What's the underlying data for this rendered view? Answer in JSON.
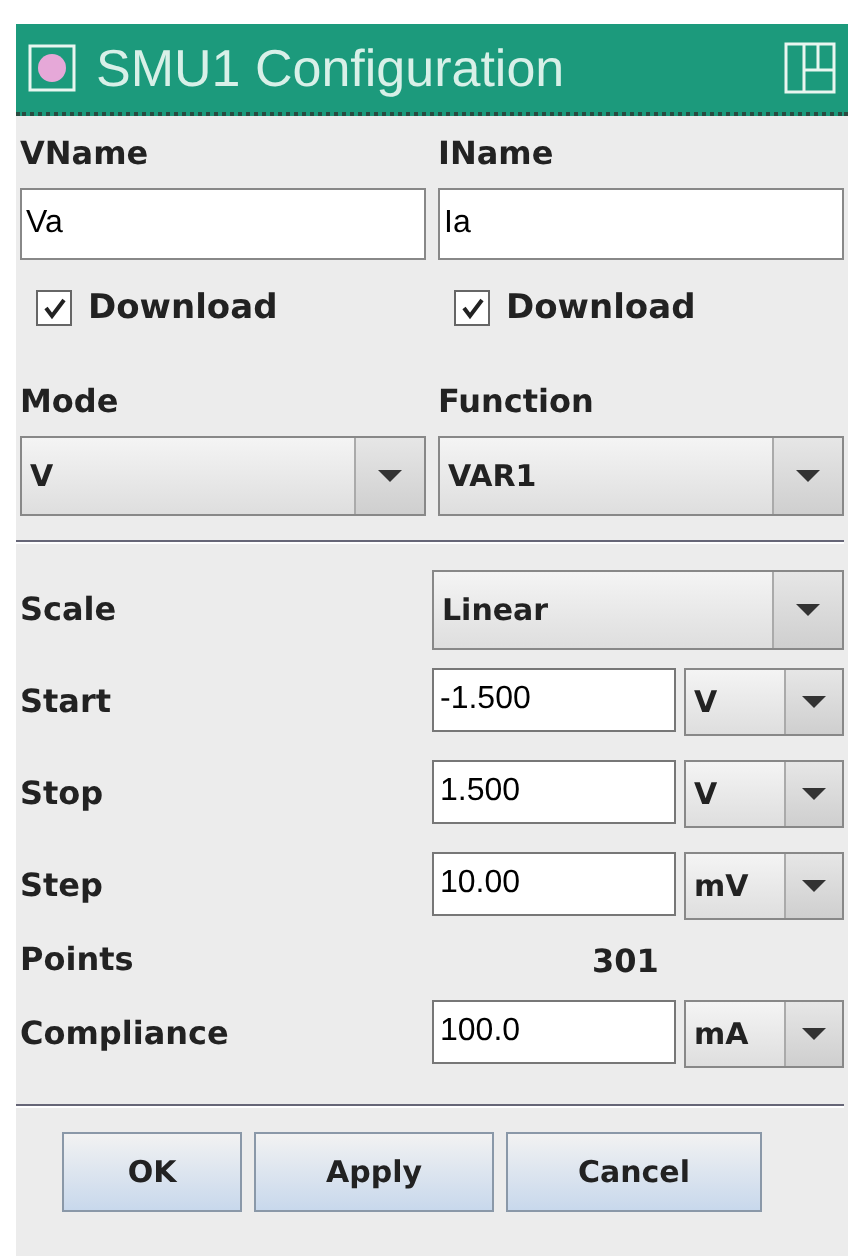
{
  "window": {
    "title": "SMU1 Configuration"
  },
  "names": [
    {
      "label": "VName",
      "value": "Va",
      "download": {
        "label": "Download",
        "checked": true
      }
    },
    {
      "label": "IName",
      "value": "Ia",
      "download": {
        "label": "Download",
        "checked": true
      }
    }
  ],
  "selectors": [
    {
      "label": "Mode",
      "value": "V"
    },
    {
      "label": "Function",
      "value": "VAR1"
    }
  ],
  "sweep": [
    {
      "kind": "combo",
      "label": "Scale",
      "value": "Linear"
    },
    {
      "kind": "number",
      "label": "Start",
      "value": "-1.500",
      "unit": "V"
    },
    {
      "kind": "number",
      "label": "Stop",
      "value": "1.500",
      "unit": "V"
    },
    {
      "kind": "number",
      "label": "Step",
      "value": "10.00",
      "unit": "mV"
    },
    {
      "kind": "readout",
      "label": "Points",
      "value": "301"
    },
    {
      "kind": "number",
      "label": "Compliance",
      "value": "100.0",
      "unit": "mA"
    }
  ],
  "buttons": [
    "OK",
    "Apply",
    "Cancel"
  ]
}
